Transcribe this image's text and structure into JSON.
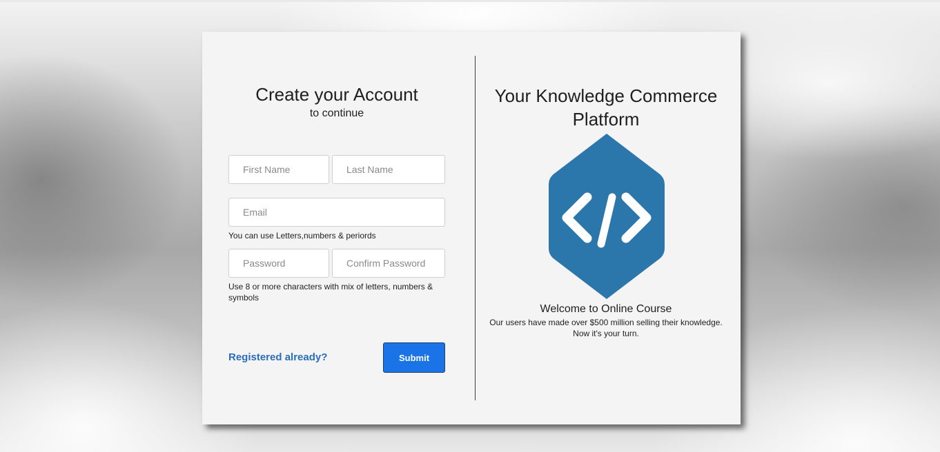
{
  "signup": {
    "title": "Create your Account",
    "subtitle": "to continue",
    "first_name_placeholder": "First Name",
    "last_name_placeholder": "Last Name",
    "email_placeholder": "Email",
    "email_hint": "You can use Letters,numbers & periords",
    "password_placeholder": "Password",
    "confirm_password_placeholder": "Confirm Password",
    "password_hint": "Use 8 or more characters with mix of letters, numbers & symbols",
    "login_link": "Registered already?",
    "submit_label": "Submit"
  },
  "promo": {
    "title": "Your Knowledge Commerce Platform",
    "logo_icon": "code-brackets-icon",
    "welcome": "Welcome to Online Course",
    "text_line1": "Our users have made over $500 million selling their knowledge.",
    "text_line2": "Now it's your turn."
  },
  "colors": {
    "accent": "#1b73e8",
    "link": "#2a6db8",
    "logo": "#2b77ab",
    "card_background": "#f4f4f4"
  }
}
